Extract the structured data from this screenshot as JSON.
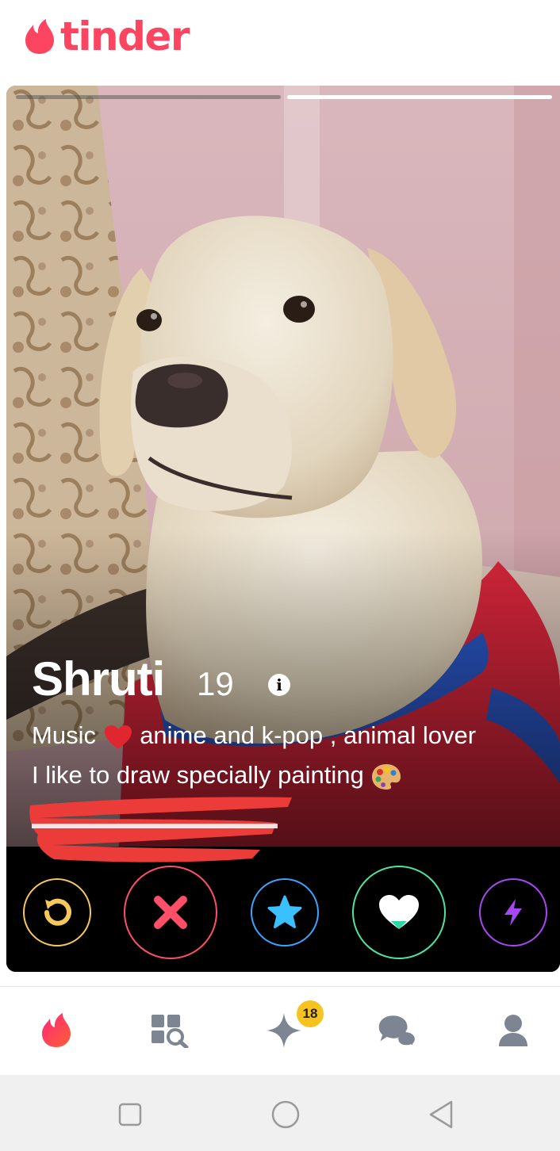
{
  "app": {
    "brand": "tinder",
    "brand_color": "#fd4561"
  },
  "card": {
    "name": "Shruti",
    "age": "19",
    "info_icon": "i",
    "bio_line1_a": "Music ",
    "bio_line1_emoji": "heart-emoji",
    "bio_line1_b": " anime and k-pop , animal lover",
    "bio_line2": "I like to draw specially painting ",
    "bio_line2_emoji": "artist-palette-emoji",
    "photo_index": 2,
    "photo_count": 2
  },
  "actions": [
    {
      "name": "rewind",
      "icon": "rewind-icon",
      "color": "#f5c85c"
    },
    {
      "name": "nope",
      "icon": "close-icon",
      "color": "#fd5068"
    },
    {
      "name": "super-like",
      "icon": "star-icon",
      "color": "#3ca4ff"
    },
    {
      "name": "like",
      "icon": "heart-icon",
      "color": "#4ee3a0"
    },
    {
      "name": "boost",
      "icon": "lightning-icon",
      "color": "#a649f3"
    }
  ],
  "tabs": [
    {
      "name": "home",
      "icon": "flame-icon",
      "active": true
    },
    {
      "name": "explore",
      "icon": "explore-grid-icon"
    },
    {
      "name": "likes",
      "icon": "sparkle-icon",
      "badge": "18"
    },
    {
      "name": "messages",
      "icon": "chat-icon"
    },
    {
      "name": "profile",
      "icon": "person-icon"
    }
  ],
  "system_nav": [
    "square-icon",
    "circle-icon",
    "back-triangle-icon"
  ]
}
